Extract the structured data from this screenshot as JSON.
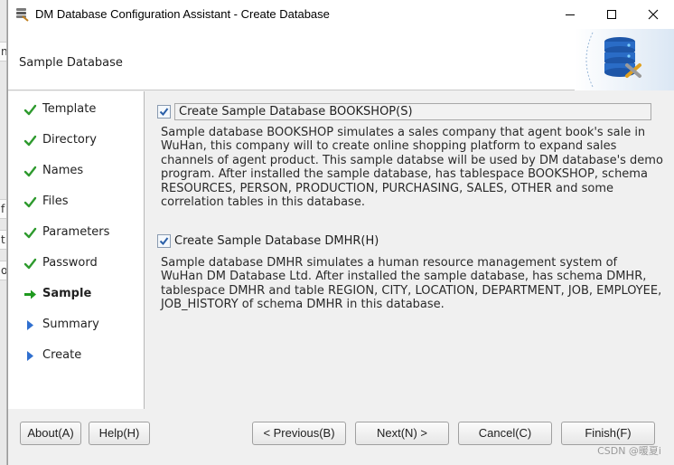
{
  "window": {
    "title": "DM Database Configuration Assistant - Create Database"
  },
  "header": {
    "title": "Sample Database"
  },
  "background_fragments": [
    "n",
    "f",
    "t",
    "o"
  ],
  "steps": [
    {
      "label": "Template",
      "state": "done"
    },
    {
      "label": "Directory",
      "state": "done"
    },
    {
      "label": "Names",
      "state": "done"
    },
    {
      "label": "Files",
      "state": "done"
    },
    {
      "label": "Parameters",
      "state": "done"
    },
    {
      "label": "Password",
      "state": "done"
    },
    {
      "label": "Sample",
      "state": "current"
    },
    {
      "label": "Summary",
      "state": "pending"
    },
    {
      "label": "Create",
      "state": "pending"
    }
  ],
  "options": {
    "bookshop": {
      "label": "Create Sample Database BOOKSHOP(S)",
      "checked": true,
      "description": "Sample database BOOKSHOP simulates a sales company that agent book's sale in\nWuHan, this company will to create online shopping platform to expand sales\nchannels of agent product. This sample databse will be used by DM database's demo\nprogram. After installed the sample database, has tablespace BOOKSHOP, schema\nRESOURCES, PERSON, PRODUCTION, PURCHASING, SALES, OTHER and some\ncorrelation tables in this database."
    },
    "dmhr": {
      "label": "Create Sample Database DMHR(H)",
      "checked": true,
      "description": "Sample database DMHR simulates a human resource management system of\nWuHan DM Database Ltd. After installed the sample database, has schema DMHR,\ntablespace DMHR and table REGION, CITY, LOCATION, DEPARTMENT, JOB, EMPLOYEE,\nJOB_HISTORY of schema DMHR in this database."
    }
  },
  "buttons": {
    "about": "About(A)",
    "help": "Help(H)",
    "previous": "< Previous(B)",
    "next": "Next(N) >",
    "cancel": "Cancel(C)",
    "finish": "Finish(F)"
  },
  "watermark": "CSDN @暖夏i",
  "colors": {
    "check_green": "#2e9a2e",
    "arrow_green": "#1f9a1f",
    "pending_blue": "#2f6fcf",
    "checkbox_blue": "#2a5fa8"
  },
  "icons": {
    "done": "checkmark-icon",
    "current": "arrow-right-icon",
    "pending": "triangle-right-icon"
  }
}
